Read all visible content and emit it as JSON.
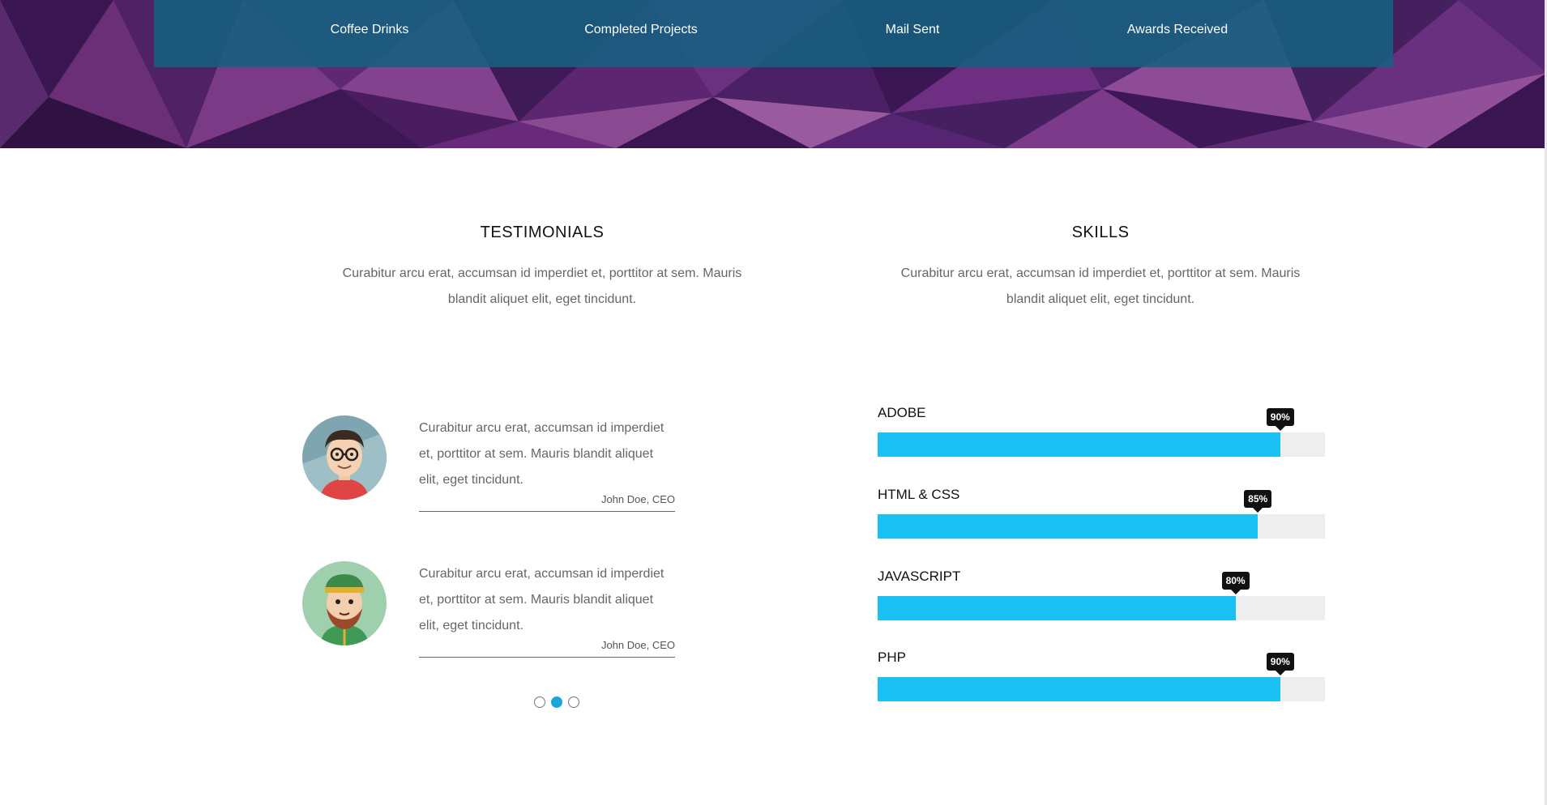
{
  "stats": [
    {
      "label": "Coffee Drinks"
    },
    {
      "label": "Completed Projects"
    },
    {
      "label": "Mail Sent"
    },
    {
      "label": "Awards Received"
    }
  ],
  "testimonials_section": {
    "title": "TESTIMONIALS",
    "description": "Curabitur arcu erat, accumsan id imperdiet et, porttitor at sem. Mauris blandit aliquet elit, eget tincidunt.",
    "items": [
      {
        "quote": "Curabitur arcu erat, accumsan id imperdiet et, porttitor at sem. Mauris blandit aliquet elit, eget tincidunt.",
        "author": "John Doe, CEO",
        "avatar": "avatar-glasses-man-icon"
      },
      {
        "quote": "Curabitur arcu erat, accumsan id imperdiet et, porttitor at sem. Mauris blandit aliquet elit, eget tincidunt.",
        "author": "John Doe, CEO",
        "avatar": "avatar-bearded-man-icon"
      }
    ],
    "pagination": {
      "count": 3,
      "active_index": 1
    }
  },
  "skills_section": {
    "title": "SKILLS",
    "description": "Curabitur arcu erat, accumsan id imperdiet et, porttitor at sem. Mauris blandit aliquet elit, eget tincidunt.",
    "items": [
      {
        "name": "ADOBE",
        "percent": 90,
        "percent_label": "90%"
      },
      {
        "name": "HTML & CSS",
        "percent": 85,
        "percent_label": "85%"
      },
      {
        "name": "JAVASCRIPT",
        "percent": 80,
        "percent_label": "80%"
      },
      {
        "name": "PHP",
        "percent": 90,
        "percent_label": "90%"
      }
    ]
  },
  "colors": {
    "accent": "#1bc0f4",
    "stats_bar": "#166080",
    "hero_bg": "#4a1f5c"
  }
}
